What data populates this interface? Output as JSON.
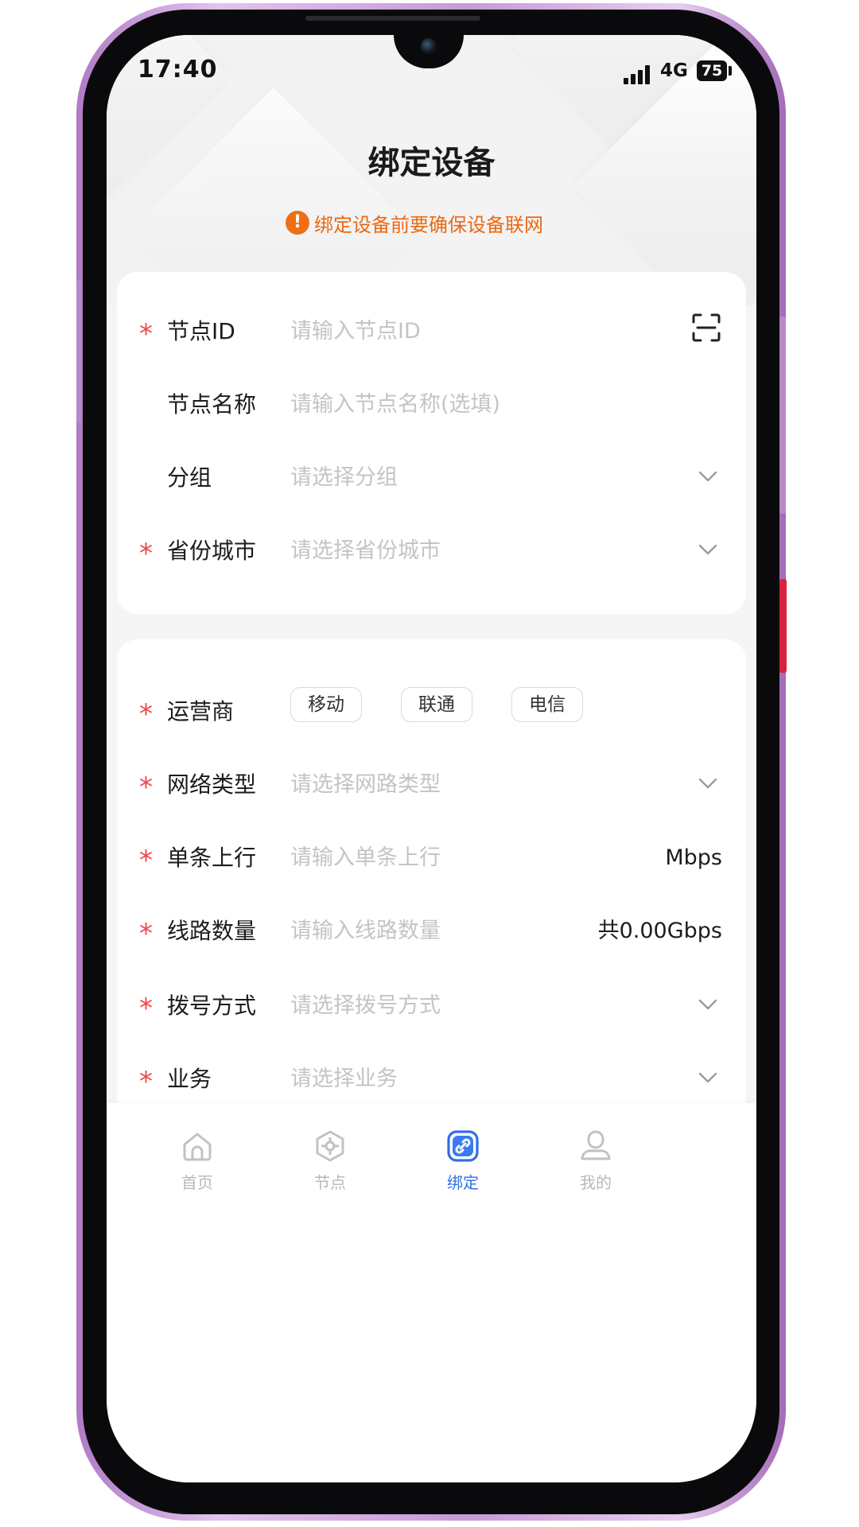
{
  "status_bar": {
    "time": "17:40",
    "network": "4G",
    "battery": "75"
  },
  "header": {
    "title": "绑定设备",
    "warning": "绑定设备前要确保设备联网",
    "warning_icon": "!"
  },
  "form1": {
    "node_id": {
      "label": "节点ID",
      "placeholder": "请输入节点ID",
      "required": true
    },
    "node_name": {
      "label": "节点名称",
      "placeholder": "请输入节点名称(选填)",
      "required": false
    },
    "group": {
      "label": "分组",
      "placeholder": "请选择分组",
      "required": false
    },
    "region": {
      "label": "省份城市",
      "placeholder": "请选择省份城市",
      "required": true
    }
  },
  "form2": {
    "carrier": {
      "label": "运营商",
      "options": [
        "移动",
        "联通",
        "电信"
      ],
      "required": true
    },
    "network_type": {
      "label": "网络类型",
      "placeholder": "请选择网路类型",
      "required": true
    },
    "uplink": {
      "label": "单条上行",
      "placeholder": "请输入单条上行",
      "unit": "Mbps",
      "required": true
    },
    "line_count": {
      "label": "线路数量",
      "placeholder": "请输入线路数量",
      "total": "共0.00Gbps",
      "required": true
    },
    "dial_mode": {
      "label": "拨号方式",
      "placeholder": "请选择拨号方式",
      "required": true
    },
    "business": {
      "label": "业务",
      "placeholder": "请选择业务",
      "required": true
    }
  },
  "required_mark": "*",
  "tabbar": {
    "items": [
      {
        "label": "首页",
        "icon": "home-icon",
        "active": false
      },
      {
        "label": "节点",
        "icon": "node-icon",
        "active": false
      },
      {
        "label": "绑定",
        "icon": "link-icon",
        "active": true
      },
      {
        "label": "我的",
        "icon": "user-icon",
        "active": false
      }
    ]
  },
  "colors": {
    "accent": "#2f6fe6",
    "warning": "#ea6a10",
    "required": "#f04848",
    "placeholder": "#c4c4c8",
    "frame": "#c79ad6"
  }
}
